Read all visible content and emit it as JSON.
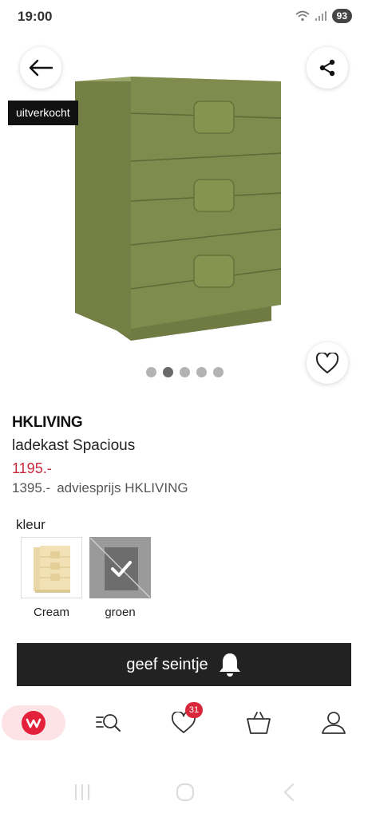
{
  "status": {
    "time": "19:00",
    "battery": "93"
  },
  "hero": {
    "badge": "uitverkocht",
    "image_count": 5,
    "active_image": 1
  },
  "product": {
    "brand": "HKLIVING",
    "name": "ladekast Spacious",
    "price": "1195.-",
    "list_price": "1395.-",
    "list_price_label": "adviesprijs HKLIVING"
  },
  "colors": {
    "label": "kleur",
    "options": [
      {
        "name": "Cream",
        "selected": false,
        "sold_out": false
      },
      {
        "name": "groen",
        "selected": true,
        "sold_out": true
      }
    ]
  },
  "notify": {
    "label": "geef seintje"
  },
  "nav": {
    "items": [
      {
        "id": "home",
        "icon": "wehkamp-logo-icon"
      },
      {
        "id": "search",
        "icon": "search-menu-icon"
      },
      {
        "id": "favorites",
        "icon": "heart-icon",
        "badge": "31"
      },
      {
        "id": "cart",
        "icon": "shopping-bag-icon"
      },
      {
        "id": "account",
        "icon": "user-icon"
      }
    ]
  },
  "theme": {
    "accent": "#c8283c",
    "dresser": "#7f8c4e",
    "button": "#222222"
  }
}
